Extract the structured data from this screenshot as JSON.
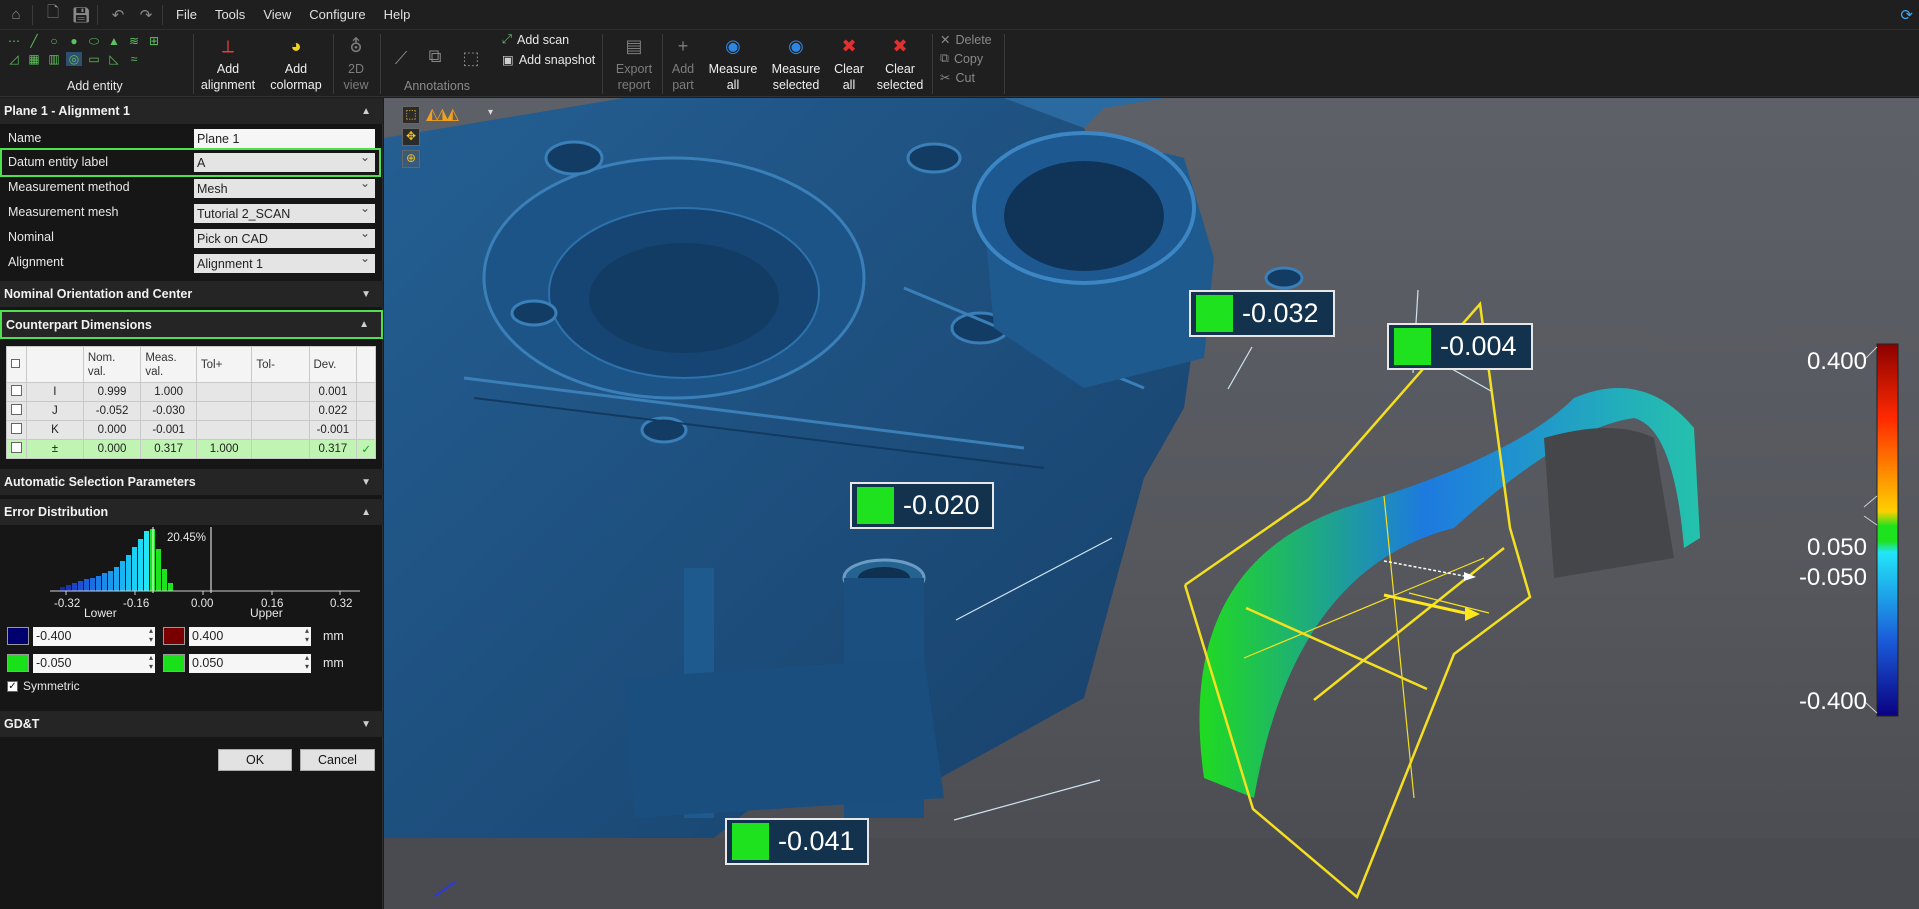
{
  "topbar": {
    "menu": [
      "File",
      "Tools",
      "View",
      "Configure",
      "Help"
    ]
  },
  "ribbon": {
    "add_entity_label": "Add entity",
    "add_alignment": [
      "Add",
      "alignment"
    ],
    "add_colormap": [
      "Add",
      "colormap"
    ],
    "view_2d": [
      "2D",
      "view"
    ],
    "annotations_label": "Annotations",
    "add_scan": "Add scan",
    "add_snapshot": "Add snapshot",
    "export_report": [
      "Export",
      "report"
    ],
    "add_part": [
      "Add",
      "part"
    ],
    "measure_all": [
      "Measure",
      "all"
    ],
    "measure_selected": [
      "Measure",
      "selected"
    ],
    "clear_all": [
      "Clear",
      "all"
    ],
    "clear_selected": [
      "Clear",
      "selected"
    ],
    "delete": "Delete",
    "copy": "Copy",
    "cut": "Cut"
  },
  "panel": {
    "title": "Plane 1 - Alignment 1",
    "props": [
      {
        "label": "Name",
        "value": "Plane 1"
      },
      {
        "label": "Datum entity label",
        "value": "A"
      },
      {
        "label": "Measurement method",
        "value": "Mesh"
      },
      {
        "label": "Measurement mesh",
        "value": "Tutorial 2_SCAN"
      },
      {
        "label": "Nominal",
        "value": "Pick on CAD"
      },
      {
        "label": "Alignment",
        "value": "Alignment 1"
      }
    ],
    "nominal_section": "Nominal Orientation and Center",
    "counterpart_section": "Counterpart Dimensions",
    "table": {
      "headers": [
        "",
        "",
        "Nom. val.",
        "Meas. val.",
        "Tol+",
        "Tol-",
        "Dev."
      ],
      "rows": [
        {
          "name": "I",
          "nom": "0.999",
          "meas": "1.000",
          "tolp": "",
          "tolm": "",
          "dev": "0.001"
        },
        {
          "name": "J",
          "nom": "-0.052",
          "meas": "-0.030",
          "tolp": "",
          "tolm": "",
          "dev": "0.022"
        },
        {
          "name": "K",
          "nom": "0.000",
          "meas": "-0.001",
          "tolp": "",
          "tolm": "",
          "dev": "-0.001"
        },
        {
          "name": "±",
          "nom": "0.000",
          "meas": "0.317",
          "tolp": "1.000",
          "tolm": "",
          "dev": "0.317"
        }
      ]
    },
    "auto_section": "Automatic Selection Parameters",
    "error_section": "Error Distribution",
    "histogram": {
      "peak_label": "20.45%",
      "ticks": [
        "-0.32",
        "-0.16",
        "0.00",
        "0.16",
        "0.32"
      ],
      "lower_label": "Lower",
      "upper_label": "Upper"
    },
    "bounds": {
      "lower_outer": "-0.400",
      "upper_outer": "0.400",
      "lower_inner": "-0.050",
      "upper_inner": "0.050",
      "unit": "mm",
      "outer_low_color": "#00006e",
      "outer_high_color": "#7a0000",
      "inner_color": "#19e019"
    },
    "symmetric_label": "Symmetric",
    "gdt_section": "GD&T",
    "ok_label": "OK",
    "cancel_label": "Cancel"
  },
  "viewport": {
    "callouts": [
      "-0.032",
      "-0.004",
      "-0.020",
      "-0.041"
    ],
    "color_scale": {
      "labels": [
        "0.400",
        "0.050",
        "-0.050",
        "-0.400"
      ]
    },
    "part_color": "#1e5b8f"
  }
}
